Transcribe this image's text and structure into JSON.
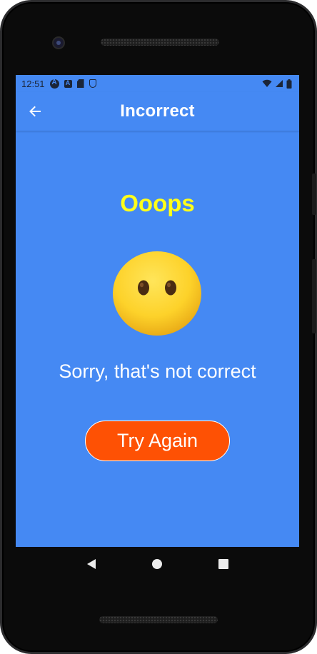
{
  "status_bar": {
    "time": "12:51",
    "left_icons": [
      "a-circle-icon",
      "a-square-icon",
      "sd-card-icon",
      "shield-icon"
    ],
    "right_icons": [
      "wifi-icon",
      "signal-icon",
      "battery-icon"
    ]
  },
  "app_bar": {
    "title": "Incorrect",
    "back_icon": "arrow-left-icon"
  },
  "main": {
    "heading": "Ooops",
    "emoji": "face-without-mouth",
    "message": "Sorry, that's not correct",
    "button_label": "Try Again"
  },
  "colors": {
    "background": "#4589f3",
    "heading": "#ffff1a",
    "button": "#fe5104",
    "text": "#ffffff"
  },
  "nav_bar": {
    "icons": [
      "nav-back-icon",
      "nav-home-icon",
      "nav-recents-icon"
    ]
  }
}
